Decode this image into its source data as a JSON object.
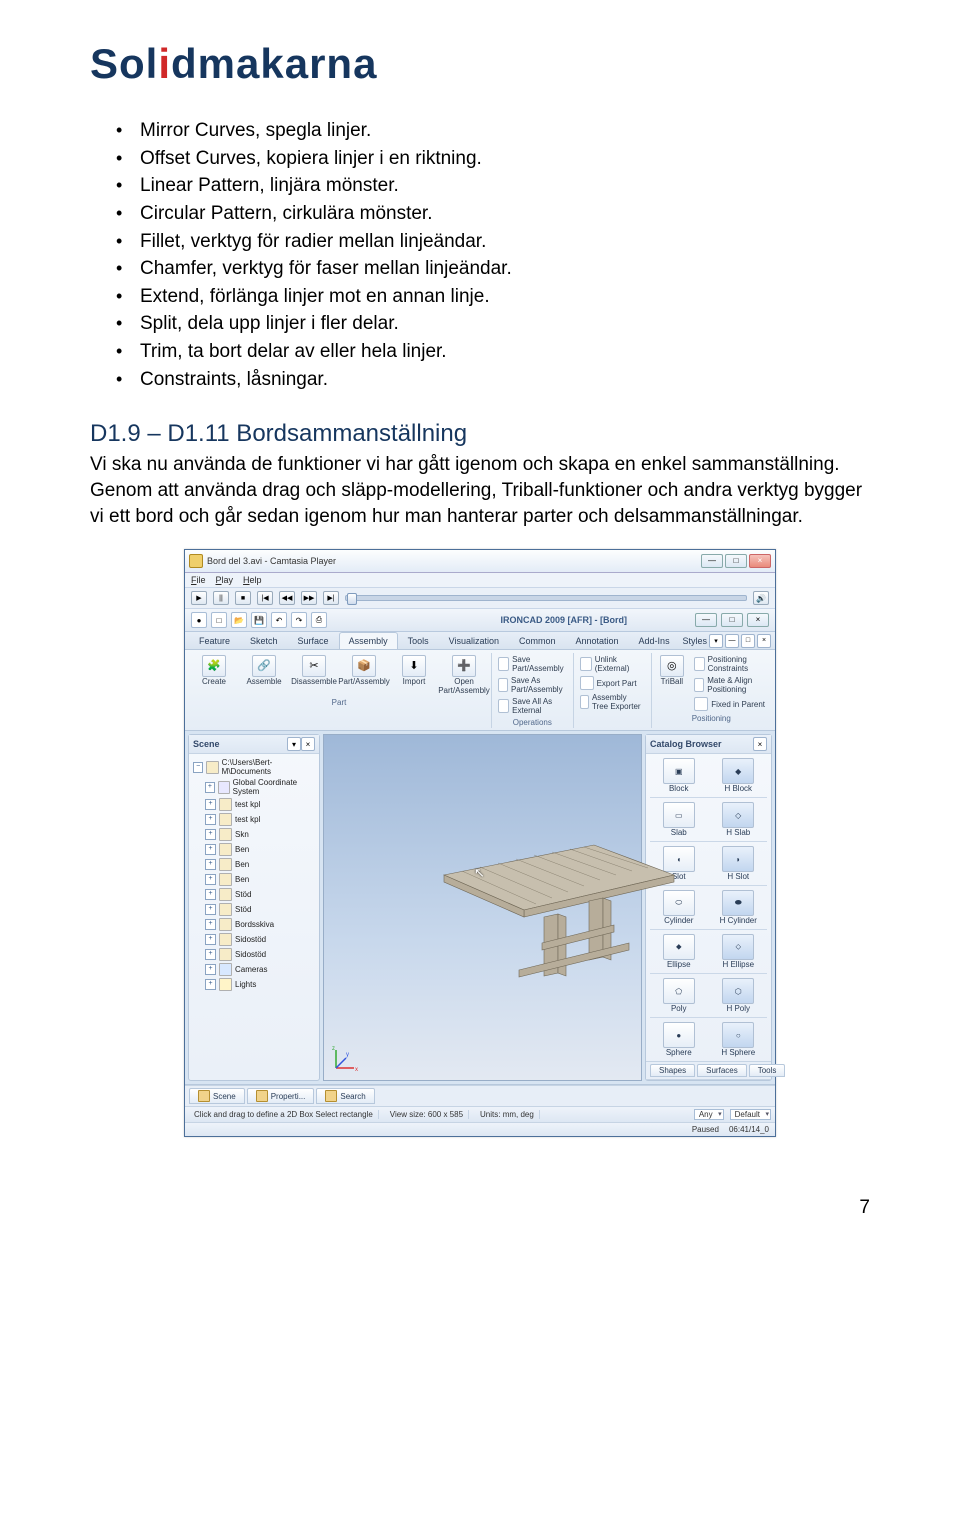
{
  "logo": {
    "pre": "Sol",
    "accent": "i",
    "post": "dmakarna"
  },
  "bullets": [
    "Mirror Curves, spegla linjer.",
    "Offset Curves, kopiera linjer i en riktning.",
    "Linear Pattern, linjära mönster.",
    "Circular Pattern, cirkulära mönster.",
    "Fillet, verktyg för radier mellan linjeändar.",
    "Chamfer, verktyg för faser mellan linjeändar.",
    "Extend, förlänga linjer mot en annan linje.",
    "Split, dela upp linjer i fler delar.",
    "Trim, ta bort delar av eller hela linjer.",
    "Constraints, låsningar."
  ],
  "section": {
    "heading": "D1.9 – D1.11 Bordsammanställning",
    "body": "Vi ska nu använda de funktioner vi har gått igenom och skapa en enkel sammanställning. Genom att använda drag och släpp-modellering, Triball-funktioner och andra verktyg bygger vi ett bord och går sedan igenom hur man hanterar parter och delsammanställningar."
  },
  "app": {
    "title": "Bord del 3.avi - Camtasia Player",
    "winbtns": {
      "min": "—",
      "max": "□",
      "close": "×"
    },
    "menus": [
      "File",
      "Play",
      "Help"
    ],
    "playbar": {
      "b1": "▶",
      "b2": "||",
      "b3": "■",
      "b4": "|◀",
      "b5": "◀◀",
      "b6": "▶▶",
      "b7": "▶|",
      "speaker": "🔊"
    },
    "qat_doc": "IRONCAD 2009 [AFR] - [Bord]",
    "tabs": [
      "Feature",
      "Sketch",
      "Surface",
      "Assembly",
      "Tools",
      "Visualization",
      "Common",
      "Annotation",
      "Add-Ins"
    ],
    "styles_label": "Styles",
    "ribbon": {
      "part": {
        "create": "Create",
        "assemble": "Assemble",
        "disassemble": "Disassemble",
        "partasm": "Part/Assembly",
        "import": "Import",
        "label": "Part",
        "open": "Open",
        "openlbl": "Part/Assembly"
      },
      "ops": {
        "a": "Save Part/Assembly",
        "b": "Save As Part/Assembly",
        "c": "Save All As External",
        "d": "Unlink (External)",
        "e": "Export Part",
        "f": "Assembly Tree Exporter",
        "label": "Operations"
      },
      "pos": {
        "triball": "TriBall",
        "a": "Positioning Constraints",
        "b": "Mate & Align Positioning",
        "c": "Fixed in Parent",
        "label": "Positioning"
      }
    },
    "scene": {
      "title": "Scene",
      "close": "×",
      "items": [
        {
          "t": "C:\\Users\\Bert-M\\Documents"
        },
        {
          "t": "Global Coordinate System"
        },
        {
          "t": "test kpl"
        },
        {
          "t": "test kpl"
        },
        {
          "t": "Skn"
        },
        {
          "t": "Ben"
        },
        {
          "t": "Ben"
        },
        {
          "t": "Ben"
        },
        {
          "t": "Stöd"
        },
        {
          "t": "Stöd"
        },
        {
          "t": "Bordsskiva"
        },
        {
          "t": "Sidostöd"
        },
        {
          "t": "Sidostöd"
        },
        {
          "t": "Cameras"
        },
        {
          "t": "Lights"
        }
      ]
    },
    "catalog": {
      "title": "Catalog Browser",
      "close": "×",
      "items": [
        {
          "a": "Block",
          "b": "H Block"
        },
        {
          "a": "Slab",
          "b": "H Slab"
        },
        {
          "a": "Slot",
          "b": "H Slot"
        },
        {
          "a": "Cylinder",
          "b": "H Cylinder"
        },
        {
          "a": "Ellipse",
          "b": "H Ellipse"
        },
        {
          "a": "Poly",
          "b": "H Poly"
        },
        {
          "a": "Sphere",
          "b": "H Sphere"
        }
      ],
      "footer": {
        "a": "Shapes",
        "b": "Surfaces",
        "c": "Tools"
      }
    },
    "bottom_tabs": [
      "Scene",
      "Properti...",
      "Search"
    ],
    "status": {
      "hint": "Click and drag to define a 2D Box Select rectangle",
      "view": "View size: 600 x 585",
      "units": "Units: mm, deg",
      "combo1": "Any",
      "combo2": "Default"
    },
    "status2": {
      "paused": "Paused",
      "stamp": "06:41/14_0"
    },
    "axes": {
      "x": "x",
      "y": "y",
      "z": "z"
    }
  },
  "pagenum": "7"
}
